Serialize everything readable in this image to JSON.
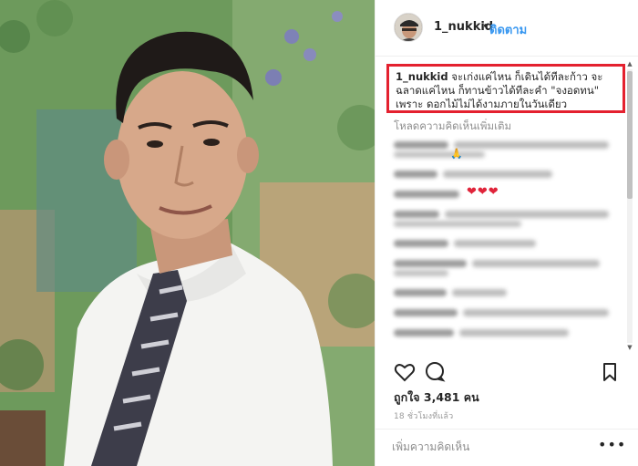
{
  "post": {
    "username": "1_nukkid",
    "separator": "•",
    "follow_label": "ติดตาม",
    "caption_user": "1_nukkid",
    "caption_text": "จะเก่งแค่ไหน ก็เดินได้ทีละก้าว จะฉลาดแค่ไหน ก็ทานข้าวได้ทีละคำ \"จงอดทน\" เพราะ ดอกไม้ไม่ได้งามภายในวันเดียว",
    "load_more_label": "โหลดความคิดเห็นเพิ่มเติม",
    "likes_text": "ถูกใจ 3,481 คน",
    "timestamp": "18 ชั่วโมงที่แล้ว",
    "comment_placeholder": "เพิ่มความคิดเห็น",
    "more_options": "•••"
  },
  "comments_blurred": true,
  "comment_hearts": "❤❤❤",
  "comment_emoji": "🙏",
  "icons": {
    "like": "heart-icon",
    "comment": "comment-icon",
    "save": "bookmark-icon",
    "more": "more-options-icon"
  },
  "colors": {
    "follow": "#3897f0",
    "highlight_box": "#e4212f",
    "heart": "#e0243a"
  }
}
